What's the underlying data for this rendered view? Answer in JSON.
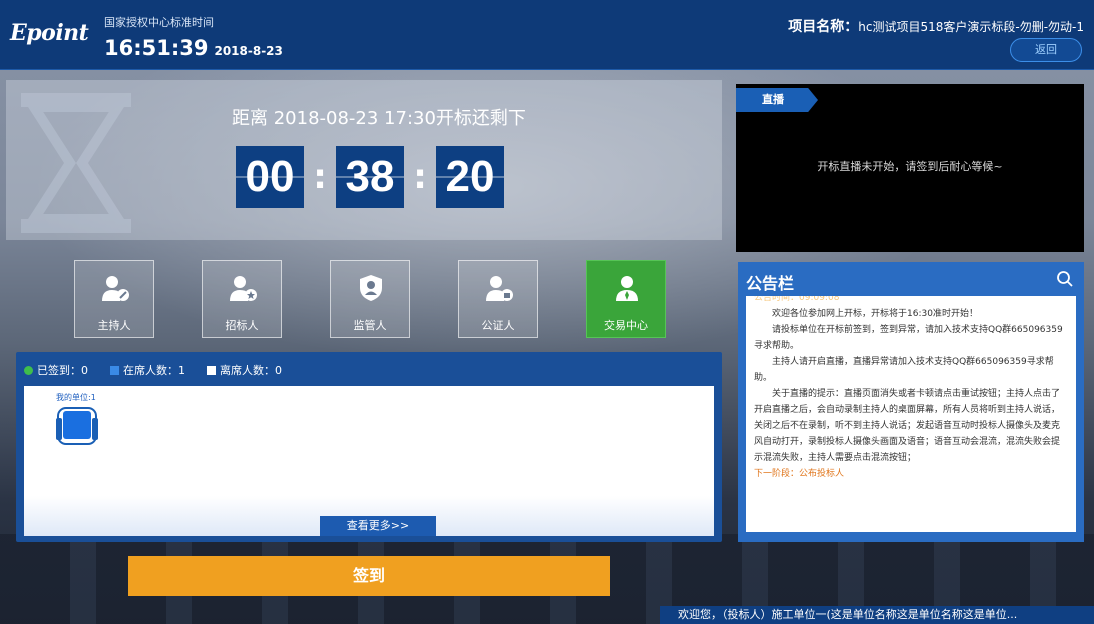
{
  "header": {
    "logo": "Epoint",
    "auth_time_label": "国家授权中心标准时间",
    "clock_time": "16:51:39",
    "clock_date": "2018-8-23",
    "project_label": "项目名称：",
    "project_name": "hc测试项目518客户演示标段-勿删-勿动-1",
    "back_label": "返回"
  },
  "countdown": {
    "title": "距离 2018-08-23 17:30开标还剩下",
    "hours": "00",
    "minutes": "38",
    "seconds": "20"
  },
  "roles": [
    {
      "label": "主持人",
      "icon": "host-icon",
      "active": false
    },
    {
      "label": "招标人",
      "icon": "tenderer-icon",
      "active": false
    },
    {
      "label": "监管人",
      "icon": "supervisor-icon",
      "active": false
    },
    {
      "label": "公证人",
      "icon": "notary-icon",
      "active": false
    },
    {
      "label": "交易中心",
      "icon": "trading-center-icon",
      "active": true
    }
  ],
  "attendance": {
    "signed": "已签到：0",
    "present": "在席人数：1",
    "absent": "离席人数：0",
    "seat_label": "我的单位:1",
    "more_label": "查看更多>>"
  },
  "sign_label": "签到",
  "live": {
    "tag": "直播",
    "message": "开标直播未开始，请签到后耐心等候~"
  },
  "notice": {
    "title": "公告栏",
    "faded_line": "公告时间：09:09:08",
    "paragraphs": [
      "欢迎各位参加网上开标，开标将于16:30准时开始！",
      "请投标单位在开标前签到，签到异常，请加入技术支持QQ群665096359寻求帮助。",
      "主持人请开启直播，直播异常请加入技术支持QQ群665096359寻求帮助。",
      "关于直播的提示：直播页面消失或者卡顿请点击重试按钮；主持人点击了开启直播之后，会自动录制主持人的桌面屏幕，所有人员将听到主持人说话，关闭之后不在录制，听不到主持人说话；发起语音互动时投标人摄像头及麦克风自动打开，录制投标人摄像头画面及语音；语音互动会混流，混流失败会提示混流失败，主持人需要点击混流按钮；"
    ],
    "next_stage": "下一阶段：公布投标人"
  },
  "welcome": "欢迎您，（投标人）施工单位一(这是单位名称这是单位名称这是单位...",
  "colors": {
    "header_bg": "#0e3a78",
    "digit_bg": "#0d3f82",
    "active_role": "#3aa53a",
    "sign_button": "#f0a020"
  }
}
